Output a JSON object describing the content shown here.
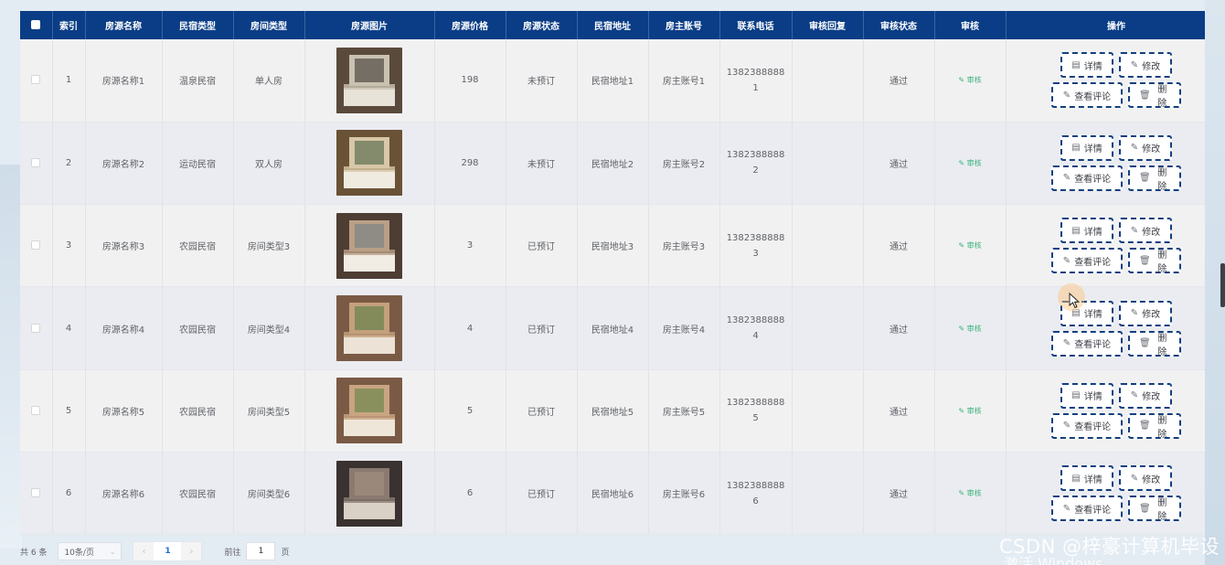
{
  "table": {
    "headers": [
      "索引",
      "房源名称",
      "民宿类型",
      "房间类型",
      "房源图片",
      "房源价格",
      "房源状态",
      "民宿地址",
      "房主账号",
      "联系电话",
      "审核回复",
      "审核状态",
      "审核",
      "操作"
    ],
    "rows": [
      {
        "index": "1",
        "name": "房源名称1",
        "bnb_type": "温泉民宿",
        "room_type": "单人房",
        "price": "198",
        "status": "未预订",
        "address": "民宿地址1",
        "owner": "房主账号1",
        "phone_a": "1382388888",
        "phone_b": "1",
        "reply": "",
        "audit_status": "通过",
        "audit_link": "审核",
        "image": "room-photo-1"
      },
      {
        "index": "2",
        "name": "房源名称2",
        "bnb_type": "运动民宿",
        "room_type": "双人房",
        "price": "298",
        "status": "未预订",
        "address": "民宿地址2",
        "owner": "房主账号2",
        "phone_a": "1382388888",
        "phone_b": "2",
        "reply": "",
        "audit_status": "通过",
        "audit_link": "审核",
        "image": "room-photo-2"
      },
      {
        "index": "3",
        "name": "房源名称3",
        "bnb_type": "农园民宿",
        "room_type": "房间类型3",
        "price": "3",
        "status": "已预订",
        "address": "民宿地址3",
        "owner": "房主账号3",
        "phone_a": "1382388888",
        "phone_b": "3",
        "reply": "",
        "audit_status": "通过",
        "audit_link": "审核",
        "image": "room-photo-3"
      },
      {
        "index": "4",
        "name": "房源名称4",
        "bnb_type": "农园民宿",
        "room_type": "房间类型4",
        "price": "4",
        "status": "已预订",
        "address": "民宿地址4",
        "owner": "房主账号4",
        "phone_a": "1382388888",
        "phone_b": "4",
        "reply": "",
        "audit_status": "通过",
        "audit_link": "审核",
        "image": "room-photo-4"
      },
      {
        "index": "5",
        "name": "房源名称5",
        "bnb_type": "农园民宿",
        "room_type": "房间类型5",
        "price": "5",
        "status": "已预订",
        "address": "民宿地址5",
        "owner": "房主账号5",
        "phone_a": "1382388888",
        "phone_b": "5",
        "reply": "",
        "audit_status": "通过",
        "audit_link": "审核",
        "image": "room-photo-5"
      },
      {
        "index": "6",
        "name": "房源名称6",
        "bnb_type": "农园民宿",
        "room_type": "房间类型6",
        "price": "6",
        "status": "已预订",
        "address": "民宿地址6",
        "owner": "房主账号6",
        "phone_a": "1382388888",
        "phone_b": "6",
        "reply": "",
        "audit_status": "通过",
        "audit_link": "审核",
        "image": "room-photo-6"
      }
    ],
    "actions": {
      "detail": "详情",
      "edit": "修改",
      "reviews": "查看评论",
      "delete": "删除"
    }
  },
  "pagination": {
    "total": "共 6 条",
    "page_size": "10条/页",
    "current_page": "1",
    "goto_label": "前往",
    "goto_value": "1",
    "goto_suffix": "页"
  },
  "watermark": "CSDN @梓豪计算机毕设",
  "os_overlay": "激活 Windows",
  "colors": {
    "header_bg": "#0a3d86",
    "action_border": "#123f80",
    "audit_link": "#3bb37a",
    "page_active": "#1f6fd6"
  },
  "icons": {
    "detail": "document-icon",
    "edit": "pencil-icon",
    "reviews": "pencil-icon",
    "delete": "trash-icon",
    "audit": "pencil-icon"
  }
}
